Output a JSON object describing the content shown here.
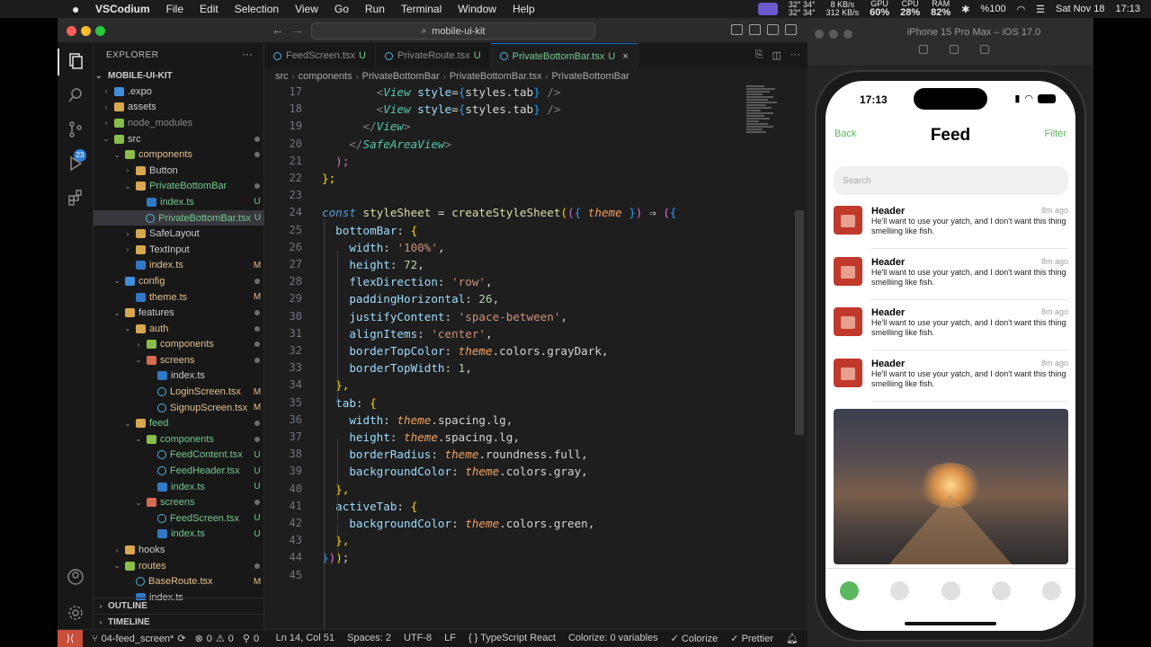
{
  "menubar": {
    "app": "VSCodium",
    "items": [
      "File",
      "Edit",
      "Selection",
      "View",
      "Go",
      "Run",
      "Terminal",
      "Window",
      "Help"
    ],
    "temp1": "32°",
    "temp2": "34°",
    "temp3": "32°",
    "temp4": "34°",
    "net_up": "8 KB/s",
    "net_down": "312 KB/s",
    "gpu_label": "GPU",
    "gpu": "60%",
    "cpu_label": "CPU",
    "cpu": "28%",
    "ram_label": "RAM",
    "ram": "82%",
    "battery": "%100",
    "date": "Sat Nov 18",
    "time": "17:13"
  },
  "title": {
    "search": "mobile-ui-kit"
  },
  "activity": {
    "badge": "23"
  },
  "explorer": {
    "title": "EXPLORER",
    "project": "MOBILE-UI-KIT",
    "rows": [
      {
        "name": ".expo",
        "depth": 1,
        "type": "folder",
        "color": "blu",
        "chev": "›",
        "dot": false,
        "stat": ""
      },
      {
        "name": "assets",
        "depth": 1,
        "type": "folder",
        "color": "",
        "chev": "›",
        "dot": false,
        "stat": ""
      },
      {
        "name": "node_modules",
        "depth": 1,
        "type": "folder",
        "color": "grn",
        "chev": "›",
        "dot": false,
        "stat": "",
        "dim": true
      },
      {
        "name": "src",
        "depth": 1,
        "type": "folder",
        "color": "grn",
        "chev": "⌄",
        "dot": true,
        "stat": ""
      },
      {
        "name": "components",
        "depth": 2,
        "type": "folder",
        "color": "grn",
        "chev": "⌄",
        "dot": true,
        "stat": "",
        "cls": "m"
      },
      {
        "name": "Button",
        "depth": 3,
        "type": "folder",
        "color": "",
        "chev": "›",
        "dot": false,
        "stat": ""
      },
      {
        "name": "PrivateBottomBar",
        "depth": 3,
        "type": "folder",
        "color": "",
        "chev": "⌄",
        "dot": true,
        "stat": "",
        "cls": "u"
      },
      {
        "name": "index.ts",
        "depth": 4,
        "type": "ts",
        "chev": "",
        "dot": false,
        "stat": "U",
        "cls": "u"
      },
      {
        "name": "PrivateBottomBar.tsx",
        "depth": 4,
        "type": "tsx",
        "chev": "",
        "dot": false,
        "stat": "U",
        "cls": "u",
        "sel": true
      },
      {
        "name": "SafeLayout",
        "depth": 3,
        "type": "folder",
        "color": "",
        "chev": "›",
        "dot": false,
        "stat": ""
      },
      {
        "name": "TextInput",
        "depth": 3,
        "type": "folder",
        "color": "",
        "chev": "›",
        "dot": false,
        "stat": ""
      },
      {
        "name": "index.ts",
        "depth": 3,
        "type": "ts",
        "chev": "",
        "dot": false,
        "stat": "M",
        "cls": "m"
      },
      {
        "name": "config",
        "depth": 2,
        "type": "folder",
        "color": "blu",
        "chev": "⌄",
        "dot": true,
        "stat": "",
        "cls": "m"
      },
      {
        "name": "theme.ts",
        "depth": 3,
        "type": "ts",
        "chev": "",
        "dot": false,
        "stat": "M",
        "cls": "m"
      },
      {
        "name": "features",
        "depth": 2,
        "type": "folder",
        "color": "",
        "chev": "⌄",
        "dot": true,
        "stat": ""
      },
      {
        "name": "auth",
        "depth": 3,
        "type": "folder",
        "color": "",
        "chev": "⌄",
        "dot": true,
        "stat": "",
        "cls": "m"
      },
      {
        "name": "components",
        "depth": 4,
        "type": "folder",
        "color": "grn",
        "chev": "›",
        "dot": true,
        "stat": "",
        "cls": "m"
      },
      {
        "name": "screens",
        "depth": 4,
        "type": "folder",
        "color": "red",
        "chev": "⌄",
        "dot": true,
        "stat": "",
        "cls": "m"
      },
      {
        "name": "index.ts",
        "depth": 5,
        "type": "ts",
        "chev": "",
        "dot": false,
        "stat": ""
      },
      {
        "name": "LoginScreen.tsx",
        "depth": 5,
        "type": "tsx",
        "chev": "",
        "dot": false,
        "stat": "M",
        "cls": "m"
      },
      {
        "name": "SignupScreen.tsx",
        "depth": 5,
        "type": "tsx",
        "chev": "",
        "dot": false,
        "stat": "M",
        "cls": "m"
      },
      {
        "name": "feed",
        "depth": 3,
        "type": "folder",
        "color": "",
        "chev": "⌄",
        "dot": true,
        "stat": "",
        "cls": "u"
      },
      {
        "name": "components",
        "depth": 4,
        "type": "folder",
        "color": "grn",
        "chev": "⌄",
        "dot": true,
        "stat": "",
        "cls": "u"
      },
      {
        "name": "FeedContent.tsx",
        "depth": 5,
        "type": "tsx",
        "chev": "",
        "dot": false,
        "stat": "U",
        "cls": "u"
      },
      {
        "name": "FeedHeader.tsx",
        "depth": 5,
        "type": "tsx",
        "chev": "",
        "dot": false,
        "stat": "U",
        "cls": "u"
      },
      {
        "name": "index.ts",
        "depth": 5,
        "type": "ts",
        "chev": "",
        "dot": false,
        "stat": "U",
        "cls": "u"
      },
      {
        "name": "screens",
        "depth": 4,
        "type": "folder",
        "color": "red",
        "chev": "⌄",
        "dot": true,
        "stat": "",
        "cls": "u"
      },
      {
        "name": "FeedScreen.tsx",
        "depth": 5,
        "type": "tsx",
        "chev": "",
        "dot": false,
        "stat": "U",
        "cls": "u"
      },
      {
        "name": "index.ts",
        "depth": 5,
        "type": "ts",
        "chev": "",
        "dot": false,
        "stat": "U",
        "cls": "u"
      },
      {
        "name": "hooks",
        "depth": 2,
        "type": "folder",
        "color": "",
        "chev": "›",
        "dot": false,
        "stat": ""
      },
      {
        "name": "routes",
        "depth": 2,
        "type": "folder",
        "color": "grn",
        "chev": "⌄",
        "dot": true,
        "stat": "",
        "cls": "m"
      },
      {
        "name": "BaseRoute.tsx",
        "depth": 3,
        "type": "tsx",
        "chev": "",
        "dot": false,
        "stat": "M",
        "cls": "m"
      },
      {
        "name": "index.ts",
        "depth": 3,
        "type": "ts",
        "chev": "",
        "dot": false,
        "stat": ""
      }
    ],
    "outline": "OUTLINE",
    "timeline": "TIMELINE"
  },
  "tabs": [
    {
      "label": "FeedScreen.tsx",
      "status": "U",
      "active": false
    },
    {
      "label": "PrivateRoute.tsx",
      "status": "U",
      "active": false
    },
    {
      "label": "PrivateBottomBar.tsx",
      "status": "U",
      "active": true
    }
  ],
  "breadcrumb": [
    "src",
    "components",
    "PrivateBottomBar",
    "PrivateBottomBar.tsx",
    "PrivateBottomBar"
  ],
  "editor": {
    "first_line": 17,
    "lines": [
      [
        [
          "        ",
          "pr"
        ],
        [
          "<",
          "pn"
        ],
        [
          "View",
          "tg"
        ],
        [
          " ",
          "pr"
        ],
        [
          "style",
          "at"
        ],
        [
          "=",
          "pr"
        ],
        [
          "{",
          "b3"
        ],
        [
          "styles.tab",
          "pr"
        ],
        [
          "}",
          "b3"
        ],
        [
          " />",
          "pn"
        ]
      ],
      [
        [
          "        ",
          "pr"
        ],
        [
          "<",
          "pn"
        ],
        [
          "View",
          "tg"
        ],
        [
          " ",
          "pr"
        ],
        [
          "style",
          "at"
        ],
        [
          "=",
          "pr"
        ],
        [
          "{",
          "b3"
        ],
        [
          "styles.tab",
          "pr"
        ],
        [
          "}",
          "b3"
        ],
        [
          " />",
          "pn"
        ]
      ],
      [
        [
          "      ",
          "pr"
        ],
        [
          "</",
          "pn"
        ],
        [
          "View",
          "tg"
        ],
        [
          ">",
          "pn"
        ]
      ],
      [
        [
          "    ",
          "pr"
        ],
        [
          "</",
          "pn"
        ],
        [
          "SafeAreaView",
          "tg"
        ],
        [
          ">",
          "pn"
        ]
      ],
      [
        [
          "  ",
          "pr"
        ],
        [
          ");",
          "b2"
        ]
      ],
      [
        [
          "};",
          "b1"
        ]
      ],
      [
        [
          "",
          "pr"
        ]
      ],
      [
        [
          "const",
          "k"
        ],
        [
          " ",
          "pr"
        ],
        [
          "styleSheet",
          "fn"
        ],
        [
          " = ",
          "pr"
        ],
        [
          "createStyleSheet",
          "fn"
        ],
        [
          "(",
          "b1"
        ],
        [
          "(",
          "b2"
        ],
        [
          "{",
          "b3"
        ],
        [
          " ",
          "pr"
        ],
        [
          "theme",
          "th"
        ],
        [
          " ",
          "pr"
        ],
        [
          "}",
          "b3"
        ],
        [
          ")",
          "b2"
        ],
        [
          " ⇒ ",
          "pr"
        ],
        [
          "(",
          "b2"
        ],
        [
          "{",
          "b3"
        ]
      ],
      [
        [
          "  ",
          "pr"
        ],
        [
          "bottomBar",
          "at"
        ],
        [
          ": ",
          "pr"
        ],
        [
          "{",
          "b1"
        ]
      ],
      [
        [
          "    ",
          "pr"
        ],
        [
          "width",
          "at"
        ],
        [
          ": ",
          "pr"
        ],
        [
          "'100%'",
          "str"
        ],
        [
          ",",
          "pr"
        ]
      ],
      [
        [
          "    ",
          "pr"
        ],
        [
          "height",
          "at"
        ],
        [
          ": ",
          "pr"
        ],
        [
          "72",
          "num"
        ],
        [
          ",",
          "pr"
        ]
      ],
      [
        [
          "    ",
          "pr"
        ],
        [
          "flexDirection",
          "at"
        ],
        [
          ": ",
          "pr"
        ],
        [
          "'row'",
          "str"
        ],
        [
          ",",
          "pr"
        ]
      ],
      [
        [
          "    ",
          "pr"
        ],
        [
          "paddingHorizontal",
          "at"
        ],
        [
          ": ",
          "pr"
        ],
        [
          "26",
          "num"
        ],
        [
          ",",
          "pr"
        ]
      ],
      [
        [
          "    ",
          "pr"
        ],
        [
          "justifyContent",
          "at"
        ],
        [
          ": ",
          "pr"
        ],
        [
          "'space-between'",
          "str"
        ],
        [
          ",",
          "pr"
        ]
      ],
      [
        [
          "    ",
          "pr"
        ],
        [
          "alignItems",
          "at"
        ],
        [
          ": ",
          "pr"
        ],
        [
          "'center'",
          "str"
        ],
        [
          ",",
          "pr"
        ]
      ],
      [
        [
          "    ",
          "pr"
        ],
        [
          "borderTopColor",
          "at"
        ],
        [
          ": ",
          "pr"
        ],
        [
          "theme",
          "th"
        ],
        [
          ".colors.grayDark,",
          "pr"
        ]
      ],
      [
        [
          "    ",
          "pr"
        ],
        [
          "borderTopWidth",
          "at"
        ],
        [
          ": ",
          "pr"
        ],
        [
          "1",
          "num"
        ],
        [
          ",",
          "pr"
        ]
      ],
      [
        [
          "  ",
          "pr"
        ],
        [
          "},",
          "b1"
        ]
      ],
      [
        [
          "  ",
          "pr"
        ],
        [
          "tab",
          "at"
        ],
        [
          ": ",
          "pr"
        ],
        [
          "{",
          "b1"
        ]
      ],
      [
        [
          "    ",
          "pr"
        ],
        [
          "width",
          "at"
        ],
        [
          ": ",
          "pr"
        ],
        [
          "theme",
          "th"
        ],
        [
          ".spacing.lg,",
          "pr"
        ]
      ],
      [
        [
          "    ",
          "pr"
        ],
        [
          "height",
          "at"
        ],
        [
          ": ",
          "pr"
        ],
        [
          "theme",
          "th"
        ],
        [
          ".spacing.lg,",
          "pr"
        ]
      ],
      [
        [
          "    ",
          "pr"
        ],
        [
          "borderRadius",
          "at"
        ],
        [
          ": ",
          "pr"
        ],
        [
          "theme",
          "th"
        ],
        [
          ".roundness.full,",
          "pr"
        ]
      ],
      [
        [
          "    ",
          "pr"
        ],
        [
          "backgroundColor",
          "at"
        ],
        [
          ": ",
          "pr"
        ],
        [
          "theme",
          "th"
        ],
        [
          ".colors.gray,",
          "pr"
        ]
      ],
      [
        [
          "  ",
          "pr"
        ],
        [
          "},",
          "b1"
        ]
      ],
      [
        [
          "  ",
          "pr"
        ],
        [
          "activeTab",
          "at"
        ],
        [
          ": ",
          "pr"
        ],
        [
          "{",
          "b1"
        ]
      ],
      [
        [
          "    ",
          "pr"
        ],
        [
          "backgroundColor",
          "at"
        ],
        [
          ": ",
          "pr"
        ],
        [
          "theme",
          "th"
        ],
        [
          ".colors.green,",
          "pr"
        ]
      ],
      [
        [
          "  ",
          "pr"
        ],
        [
          "},",
          "b1"
        ]
      ],
      [
        [
          "}",
          "b3"
        ],
        [
          ")",
          "b2"
        ],
        [
          ")",
          "b1"
        ],
        [
          ";",
          "pr"
        ]
      ],
      [
        [
          "",
          "pr"
        ]
      ]
    ]
  },
  "statusbar": {
    "branch": "04-feed_screen*",
    "errors": "0",
    "warnings": "0",
    "ports": "0",
    "position": "Ln 14, Col 51",
    "spaces": "Spaces: 2",
    "encoding": "UTF-8",
    "eol": "LF",
    "language": "TypeScript React",
    "colorize_vars": "Colorize: 0 variables",
    "colorize": "Colorize",
    "prettier": "Prettier"
  },
  "simulator": {
    "title": "iPhone 15 Pro Max – iOS 17.0",
    "time": "17:13",
    "back": "Back",
    "title_text": "Feed",
    "filter": "Filter",
    "search_placeholder": "Search",
    "items": [
      {
        "header": "Header",
        "time": "8m ago",
        "body": "He'll want to use your yatch, and I don't want this thing smelliing like fish."
      },
      {
        "header": "Header",
        "time": "8m ago",
        "body": "He'll want to use your yatch, and I don't want this thing smelliing like fish."
      },
      {
        "header": "Header",
        "time": "8m ago",
        "body": "He'll want to use your yatch, and I don't want this thing smelliing like fish."
      },
      {
        "header": "Header",
        "time": "8m ago",
        "body": "He'll want to use your yatch, and I don't want this thing smelliing like fish."
      }
    ],
    "tabs_count": 5,
    "active_tab": 0
  },
  "colors": {
    "accent": "#0078d4",
    "green": "#5cb85c",
    "untracked": "#73c991",
    "modified": "#e2c08d"
  }
}
